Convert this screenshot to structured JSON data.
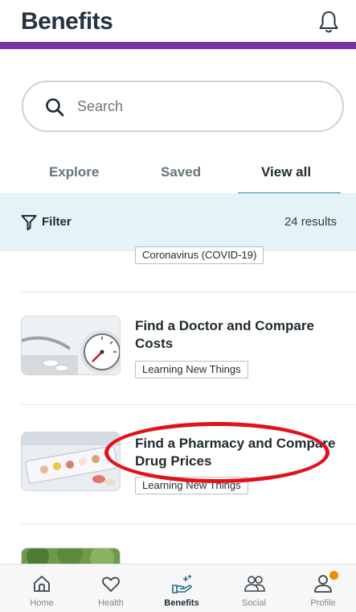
{
  "header": {
    "title": "Benefits"
  },
  "search": {
    "placeholder": "Search"
  },
  "tabs": [
    {
      "label": "Explore",
      "active": false
    },
    {
      "label": "Saved",
      "active": false
    },
    {
      "label": "View all",
      "active": true
    }
  ],
  "filter": {
    "label": "Filter",
    "results": "24 results"
  },
  "partial_card": {
    "tag": "Coronavirus (COVID-19)"
  },
  "cards": [
    {
      "title": "Find a Doctor and Compare Costs",
      "tag": "Learning New Things",
      "thumb_icon": "blood-pressure-gauge-image"
    },
    {
      "title": "Find a Pharmacy and Compare Drug Prices",
      "tag": "Learning New Things",
      "thumb_icon": "pill-organizer-image"
    }
  ],
  "nav": [
    {
      "label": "Home",
      "icon": "home-icon"
    },
    {
      "label": "Health",
      "icon": "heart-icon"
    },
    {
      "label": "Benefits",
      "icon": "benefits-hand-icon",
      "active": true
    },
    {
      "label": "Social",
      "icon": "social-people-icon"
    },
    {
      "label": "Profile",
      "icon": "profile-icon",
      "badge": true
    }
  ],
  "colors": {
    "accent_purple": "#7a2fa3",
    "tab_underline": "#1c8ea0",
    "filter_bg": "#e3f3f7",
    "annotation_red": "#e0121b",
    "badge_orange": "#f28c00"
  }
}
